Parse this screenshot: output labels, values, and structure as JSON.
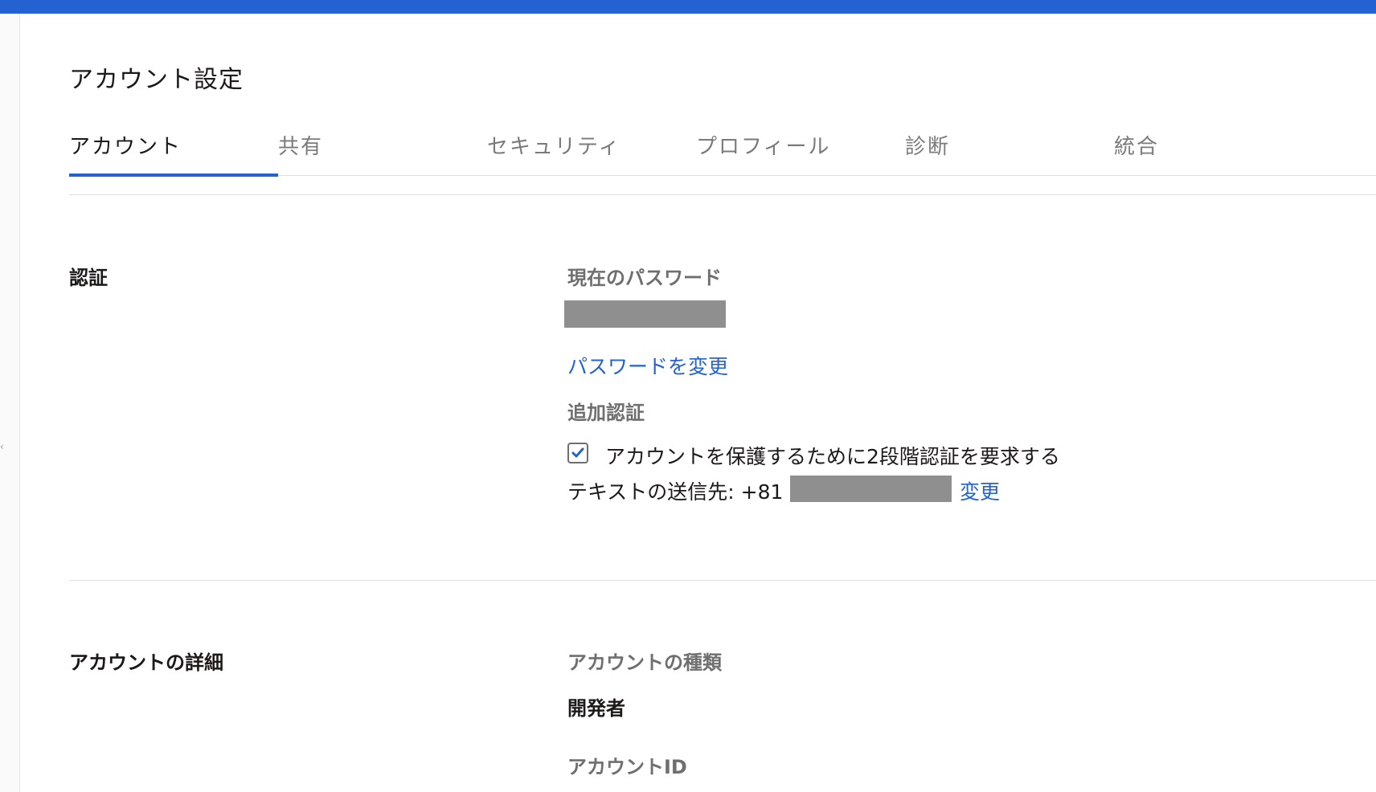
{
  "colors": {
    "accent": "#2462d1",
    "masked": "#8f8f8f",
    "muted_text": "#6f6f6f"
  },
  "page": {
    "title": "アカウント設定"
  },
  "tabs": [
    {
      "label": "アカウント",
      "active": true
    },
    {
      "label": "共有",
      "active": false
    },
    {
      "label": "セキュリティ",
      "active": false
    },
    {
      "label": "プロフィール",
      "active": false
    },
    {
      "label": "診断",
      "active": false
    },
    {
      "label": "統合",
      "active": false
    }
  ],
  "auth": {
    "section_label": "認証",
    "current_password_label": "現在のパスワード",
    "change_password_link": "パスワードを変更",
    "additional_auth_label": "追加認証",
    "two_factor_checkbox_label": "アカウントを保護するために2段階認証を要求する",
    "two_factor_checked": true,
    "text_destination_prefix": "テキストの送信先: +81",
    "change_link": "変更"
  },
  "account_details": {
    "section_label": "アカウントの詳細",
    "account_type_label": "アカウントの種類",
    "account_type_value": "開発者",
    "account_id_label": "アカウントID"
  }
}
